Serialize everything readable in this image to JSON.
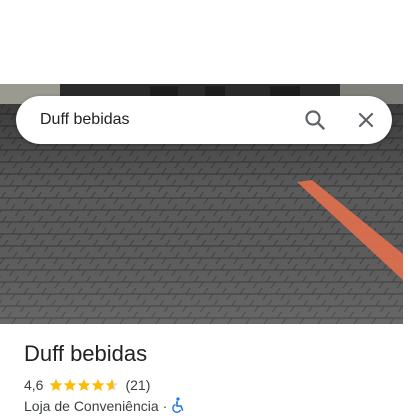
{
  "search": {
    "query": "Duff bebidas",
    "search_icon": "search-icon",
    "close_icon": "close-icon"
  },
  "photo": {
    "subject": "brick-paved-parking-lot",
    "accent_stripe_color": "#e2704e"
  },
  "place": {
    "name": "Duff bebidas",
    "rating": "4,6",
    "stars": 4.6,
    "review_count": "(21)",
    "category": "Loja de Conveniência",
    "separator": "·",
    "accessibility_icon": "wheelchair-icon"
  },
  "colors": {
    "star": "#fbbc04",
    "star_empty": "#dadce0",
    "accessibility": "#1a73e8"
  }
}
